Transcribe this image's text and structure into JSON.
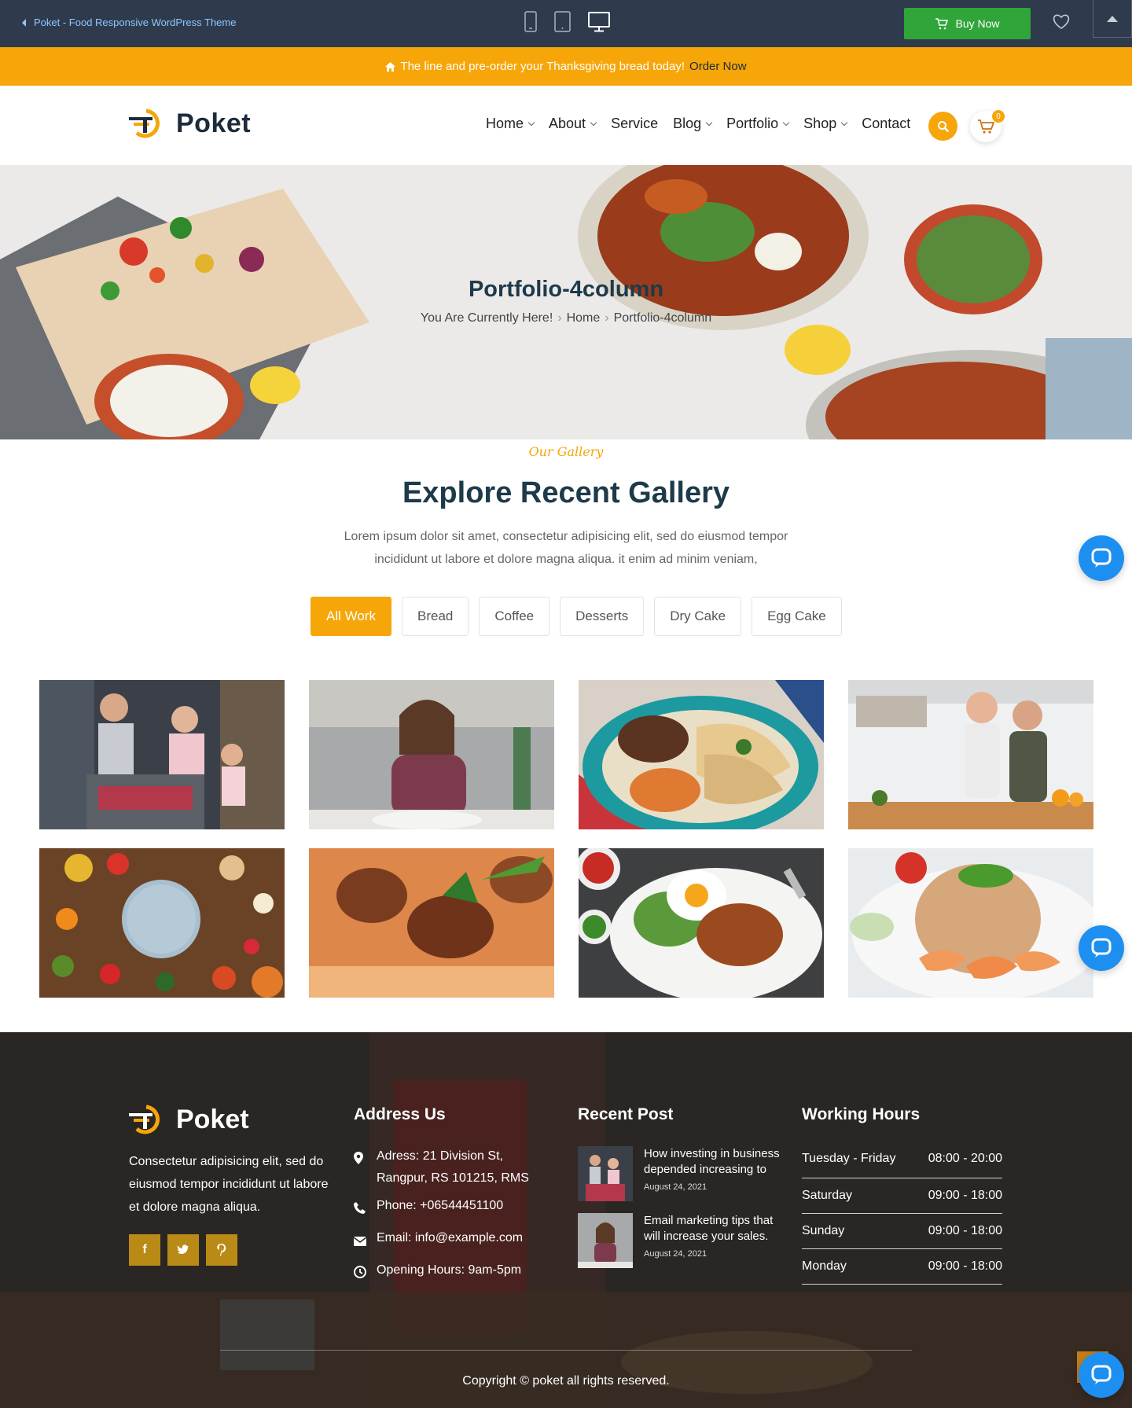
{
  "topbar": {
    "back_label": "Poket - Food Responsive WordPress Theme",
    "buy_label": "Buy Now",
    "devices": [
      "mobile-icon",
      "tablet-icon",
      "desktop-icon"
    ]
  },
  "announcement": {
    "text": "The line and pre-order your Thanksgiving bread today!",
    "link": "Order Now"
  },
  "header": {
    "brand": "Poket",
    "nav": [
      {
        "label": "Home"
      },
      {
        "label": "About"
      },
      {
        "label": "Service"
      },
      {
        "label": "Blog"
      },
      {
        "label": "Portfolio"
      },
      {
        "label": "Shop"
      },
      {
        "label": "Contact"
      }
    ],
    "cart_count": "0"
  },
  "hero": {
    "title": "Portfolio-4column",
    "crumb_intro": "You Are Currently Here!",
    "crumb_home": "Home",
    "crumb_current": "Portfolio-4column"
  },
  "gallery": {
    "kicker": "Our Gallery",
    "title": "Explore Recent Gallery",
    "desc": "Lorem ipsum dolor sit amet, consectetur adipisicing elit, sed do eiusmod tempor incididunt ut labore et dolore magna aliqua. it enim ad minim veniam,",
    "filters": [
      "All Work",
      "Bread",
      "Coffee",
      "Desserts",
      "Dry Cake",
      "Egg Cake"
    ],
    "active_filter": "All Work"
  },
  "footer": {
    "brand": "Poket",
    "about": "Consectetur adipisicing elit, sed do eiusmod tempor incididunt ut labore et dolore magna aliqua.",
    "socials": [
      "f",
      "t",
      "p"
    ],
    "address_title": "Address Us",
    "address": "Adress: 21 Division St, Rangpur, RS 101215, RMS",
    "phone": "Phone: +06544451100",
    "email": "Email: info@example.com",
    "opening": "Opening Hours: 9am-5pm",
    "recent_title": "Recent Post",
    "posts": [
      {
        "title": "How investing in business depended increasing to",
        "date": "August 24, 2021"
      },
      {
        "title": "Email marketing tips that will increase your sales.",
        "date": "August 24, 2021"
      }
    ],
    "hours_title": "Working Hours",
    "hours": [
      {
        "day": "Tuesday - Friday",
        "time": "08:00 - 20:00"
      },
      {
        "day": "Saturday",
        "time": "09:00 - 18:00"
      },
      {
        "day": "Sunday",
        "time": "09:00 - 18:00"
      },
      {
        "day": "Monday",
        "time": "09:00 - 18:00"
      }
    ],
    "copyright": "Copyright © poket all rights reserved."
  },
  "colors": {
    "accent": "#f6a609",
    "topbar": "#2f3b4c",
    "heading": "#1d3a4a",
    "buy": "#2fa53a",
    "chat": "#1d8ff0"
  }
}
